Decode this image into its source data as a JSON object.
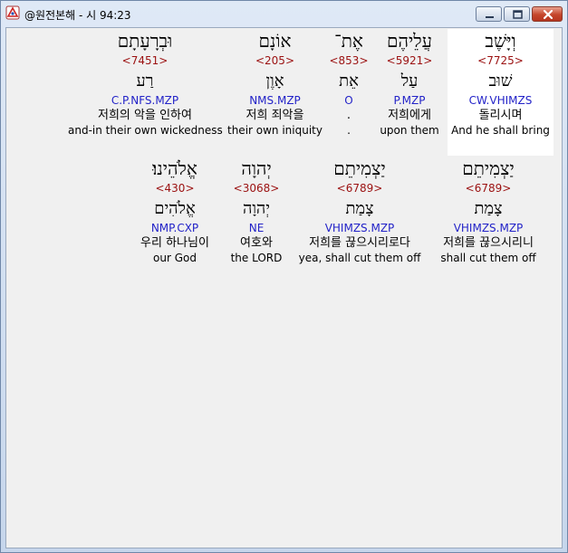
{
  "window": {
    "title": "@원전본해 - 시 94:23"
  },
  "rows": [
    [
      {
        "hebrew": "וְיָּשֶׁב",
        "strong": "<7725>",
        "lemma": "שׁוּב",
        "morph": "CW.VHIMZS",
        "korean": "돌리시며",
        "english": "And he shall bring",
        "selected": true
      },
      {
        "hebrew": "עֲלֵיהֶם",
        "strong": "<5921>",
        "lemma": "עַל",
        "morph": "P.MZP",
        "korean": "저희에게",
        "english": "upon them",
        "selected": false
      },
      {
        "hebrew": "אֶת־",
        "strong": "<853>",
        "lemma": "אֵת",
        "morph": "O",
        "korean": ".",
        "english": ".",
        "selected": false
      },
      {
        "hebrew": "אוֹנָם",
        "strong": "<205>",
        "lemma": "אָוֶן",
        "morph": "NMS.MZP",
        "korean": "저희 죄악을",
        "english": "their own iniquity",
        "selected": false
      },
      {
        "hebrew": "וּבְרָעָתָם",
        "strong": "<7451>",
        "lemma": "רַע",
        "morph": "C.P.NFS.MZP",
        "korean": "저희의 악을 인하여",
        "english": "and-in their own wickedness",
        "selected": false
      }
    ],
    [
      {
        "hebrew": "יַצְמִיתֵם",
        "strong": "<6789>",
        "lemma": "צָמַת",
        "morph": "VHIMZS.MZP",
        "korean": "저희를 끊으시리니",
        "english": "shall cut them off",
        "selected": false
      },
      {
        "hebrew": "יַצְמִיתֵם",
        "strong": "<6789>",
        "lemma": "צָמַת",
        "morph": "VHIMZS.MZP",
        "korean": "저희를 끊으시리로다",
        "english": "yea, shall cut them off",
        "selected": false
      },
      {
        "hebrew": "יְהוָה",
        "strong": "<3068>",
        "lemma": "יְהוָה",
        "morph": "NE",
        "korean": "여호와",
        "english": "the LORD",
        "selected": false
      },
      {
        "hebrew": "אֱלֹהֵינוּ׃",
        "strong": "<430>",
        "lemma": "אֱלֹהִים",
        "morph": "NMP.CXP",
        "korean": "우리 하나님이",
        "english": "our God",
        "selected": false
      }
    ]
  ]
}
